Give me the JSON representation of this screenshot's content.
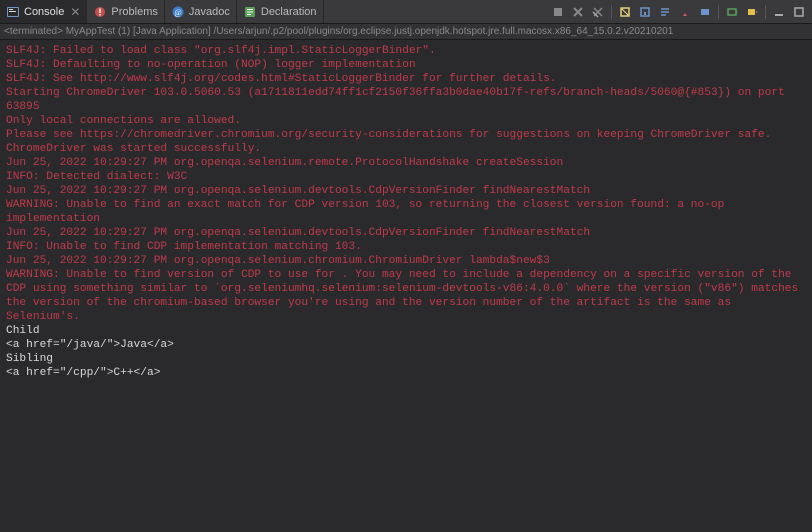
{
  "tabs": [
    {
      "label": "Console",
      "active": true,
      "closable": true
    },
    {
      "label": "Problems",
      "active": false,
      "closable": false
    },
    {
      "label": "Javadoc",
      "active": false,
      "closable": false
    },
    {
      "label": "Declaration",
      "active": false,
      "closable": false
    }
  ],
  "status": "<terminated> MyAppTest (1) [Java Application] /Users/arjun/.p2/pool/plugins/org.eclipse.justj.openjdk.hotspot.jre.full.macosx.x86_64_15.0.2.v20210201",
  "console": {
    "lines": [
      {
        "cls": "stderr",
        "text": "SLF4J: Failed to load class \"org.slf4j.impl.StaticLoggerBinder\"."
      },
      {
        "cls": "stderr",
        "text": "SLF4J: Defaulting to no-operation (NOP) logger implementation"
      },
      {
        "cls": "stderr",
        "text": "SLF4J: See http://www.slf4j.org/codes.html#StaticLoggerBinder for further details."
      },
      {
        "cls": "stderr",
        "text": "Starting ChromeDriver 103.0.5060.53 (a1711811edd74ff1cf2150f36ffa3b0dae40b17f-refs/branch-heads/5060@{#853}) on port 63895"
      },
      {
        "cls": "stderr",
        "text": "Only local connections are allowed."
      },
      {
        "cls": "stderr",
        "text": "Please see https://chromedriver.chromium.org/security-considerations for suggestions on keeping ChromeDriver safe."
      },
      {
        "cls": "stderr",
        "text": "ChromeDriver was started successfully."
      },
      {
        "cls": "stderr",
        "text": "Jun 25, 2022 10:29:27 PM org.openqa.selenium.remote.ProtocolHandshake createSession"
      },
      {
        "cls": "stderr",
        "text": "INFO: Detected dialect: W3C"
      },
      {
        "cls": "stderr",
        "text": "Jun 25, 2022 10:29:27 PM org.openqa.selenium.devtools.CdpVersionFinder findNearestMatch"
      },
      {
        "cls": "stderr",
        "text": "WARNING: Unable to find an exact match for CDP version 103, so returning the closest version found: a no-op implementation"
      },
      {
        "cls": "stderr",
        "text": "Jun 25, 2022 10:29:27 PM org.openqa.selenium.devtools.CdpVersionFinder findNearestMatch"
      },
      {
        "cls": "stderr",
        "text": "INFO: Unable to find CDP implementation matching 103."
      },
      {
        "cls": "stderr",
        "text": "Jun 25, 2022 10:29:27 PM org.openqa.selenium.chromium.ChromiumDriver lambda$new$3"
      },
      {
        "cls": "stderr",
        "text": "WARNING: Unable to find version of CDP to use for . You may need to include a dependency on a specific version of the CDP using something similar to `org.seleniumhq.selenium:selenium-devtools-v86:4.0.0` where the version (\"v86\") matches the version of the chromium-based browser you're using and the version number of the artifact is the same as Selenium's."
      },
      {
        "cls": "stdout",
        "text": "Child"
      },
      {
        "cls": "stdout",
        "text": "<a href=\"/java/\">Java</a>"
      },
      {
        "cls": "stdout",
        "text": ""
      },
      {
        "cls": "stdout",
        "text": ""
      },
      {
        "cls": "stdout",
        "text": "Sibling"
      },
      {
        "cls": "stdout",
        "text": "<a href=\"/cpp/\">C++</a>"
      }
    ]
  }
}
